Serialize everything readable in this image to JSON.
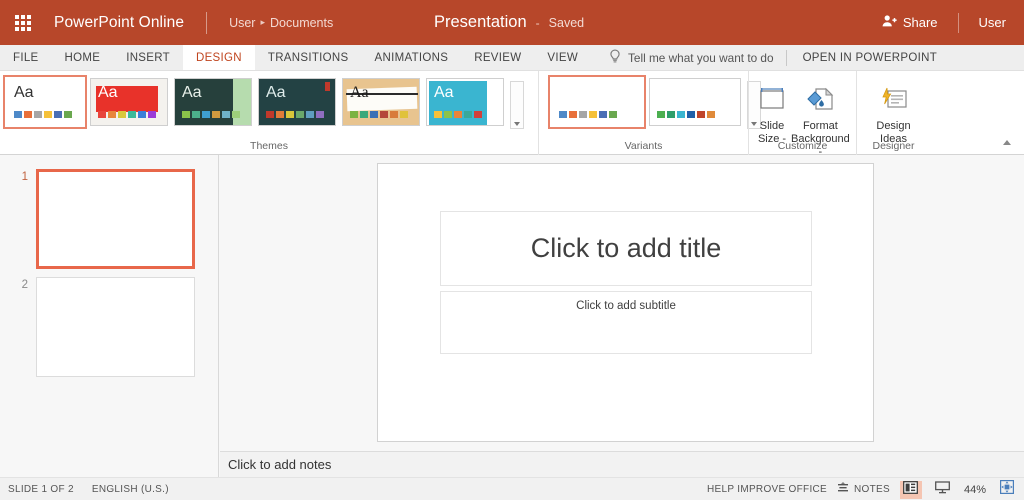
{
  "titlebar": {
    "waffle_icon": "app-launcher-waffle-icon",
    "app_name": "PowerPoint Online",
    "breadcrumb": {
      "user": "User",
      "separator": "▸",
      "folder": "Documents"
    },
    "document_title": "Presentation",
    "dash": "-",
    "save_state": "Saved",
    "share_label": "Share",
    "share_icon": "share-person-icon",
    "user_label": "User",
    "bg_color": "#b7472a"
  },
  "tabs": [
    {
      "label": "FILE",
      "active": false
    },
    {
      "label": "HOME",
      "active": false
    },
    {
      "label": "INSERT",
      "active": false
    },
    {
      "label": "DESIGN",
      "active": true
    },
    {
      "label": "TRANSITIONS",
      "active": false
    },
    {
      "label": "ANIMATIONS",
      "active": false
    },
    {
      "label": "REVIEW",
      "active": false
    },
    {
      "label": "VIEW",
      "active": false
    }
  ],
  "tellme": {
    "icon": "lightbulb-icon",
    "placeholder": "Tell me what you want to do"
  },
  "open_in_powerpoint": "OPEN IN POWERPOINT",
  "ribbon": {
    "collapse_icon": "chevron-up-icon",
    "themes": {
      "group_label": "Themes",
      "scroll_icon": "chevron-down-icon",
      "items": [
        {
          "name": "office-theme",
          "aa": "Aa",
          "selected": true,
          "bg": "#ffffff",
          "aa_color": "#333333",
          "swatches": [
            "#4e89c8",
            "#e8703a",
            "#a6a6a6",
            "#f5c13a",
            "#4a6fb5",
            "#6aa84f"
          ]
        },
        {
          "name": "berlin-theme",
          "aa": "Aa",
          "selected": false,
          "bg": "#f4f2ee",
          "aa_color": "#ffffff",
          "swatches": [
            "#e8453c",
            "#e8863c",
            "#d8c83c",
            "#3cb99a",
            "#3c7fd8",
            "#9b3cd8"
          ]
        },
        {
          "name": "facet-theme",
          "aa": "Aa",
          "selected": false,
          "bg": "#26403c",
          "aa_color": "#e8f0ea",
          "swatches": [
            "#8bc34a",
            "#4caf8b",
            "#3f9fd0",
            "#d09a3f",
            "#6fb3c9",
            "#9ecf7a"
          ]
        },
        {
          "name": "slate-theme",
          "aa": "Aa",
          "selected": false,
          "bg": "#234244",
          "aa_color": "#dfeceb",
          "swatches": [
            "#c0392b",
            "#e07b39",
            "#d8c63a",
            "#6aa86a",
            "#5f9ec0",
            "#8f6ec0"
          ]
        },
        {
          "name": "wisp-theme",
          "aa": "Aa",
          "selected": false,
          "bg": "#e8c48f",
          "aa_color": "#1a1a1a",
          "swatches": [
            "#7cb342",
            "#3aa87a",
            "#3a6fb5",
            "#b5483a",
            "#d87b3a",
            "#e0c23a"
          ]
        },
        {
          "name": "badge-theme",
          "aa": "Aa",
          "selected": false,
          "bg": "#3ab5d0",
          "aa_color": "#ffffff",
          "swatches": [
            "#f5c13a",
            "#8bc34a",
            "#e8843a",
            "#3aa89a",
            "#d0403a"
          ]
        }
      ]
    },
    "variants": {
      "group_label": "Variants",
      "scroll_icon": "chevron-down-icon",
      "items": [
        {
          "name": "variant-1",
          "selected": true,
          "swatches": [
            "#4e89c8",
            "#e8703a",
            "#a6a6a6",
            "#f5c13a",
            "#4a6fb5",
            "#6aa84f"
          ]
        },
        {
          "name": "variant-2",
          "selected": false,
          "swatches": [
            "#4caf50",
            "#2e9e6b",
            "#3ab5d0",
            "#1f5fa8",
            "#c0452b",
            "#e08a3a"
          ]
        }
      ]
    },
    "customize": {
      "group_label": "Customize",
      "buttons": [
        {
          "name": "slide-size",
          "icon": "slide-size-icon",
          "line1": "Slide",
          "line2": "Size -"
        },
        {
          "name": "format-background",
          "icon": "format-background-icon",
          "line1": "Format",
          "line2": "Background -"
        }
      ]
    },
    "designer": {
      "group_label": "Designer",
      "buttons": [
        {
          "name": "design-ideas",
          "icon": "design-ideas-icon",
          "line1": "Design",
          "line2": "Ideas"
        }
      ]
    }
  },
  "slides": [
    {
      "number": "1",
      "selected": true
    },
    {
      "number": "2",
      "selected": false
    }
  ],
  "canvas": {
    "title_placeholder": "Click to add title",
    "subtitle_placeholder": "Click to add subtitle"
  },
  "notes": {
    "placeholder": "Click to add notes"
  },
  "statusbar": {
    "slide_count": "SLIDE 1 OF 2",
    "language": "ENGLISH (U.S.)",
    "help_improve": "HELP IMPROVE OFFICE",
    "notes_label": "NOTES",
    "notes_icon": "notes-icon",
    "view_normal_icon": "normal-view-icon",
    "view_slideshow_icon": "slideshow-view-icon",
    "zoom": "44%",
    "fit_icon": "fit-to-window-icon",
    "accent_color": "#f5c5b2"
  }
}
